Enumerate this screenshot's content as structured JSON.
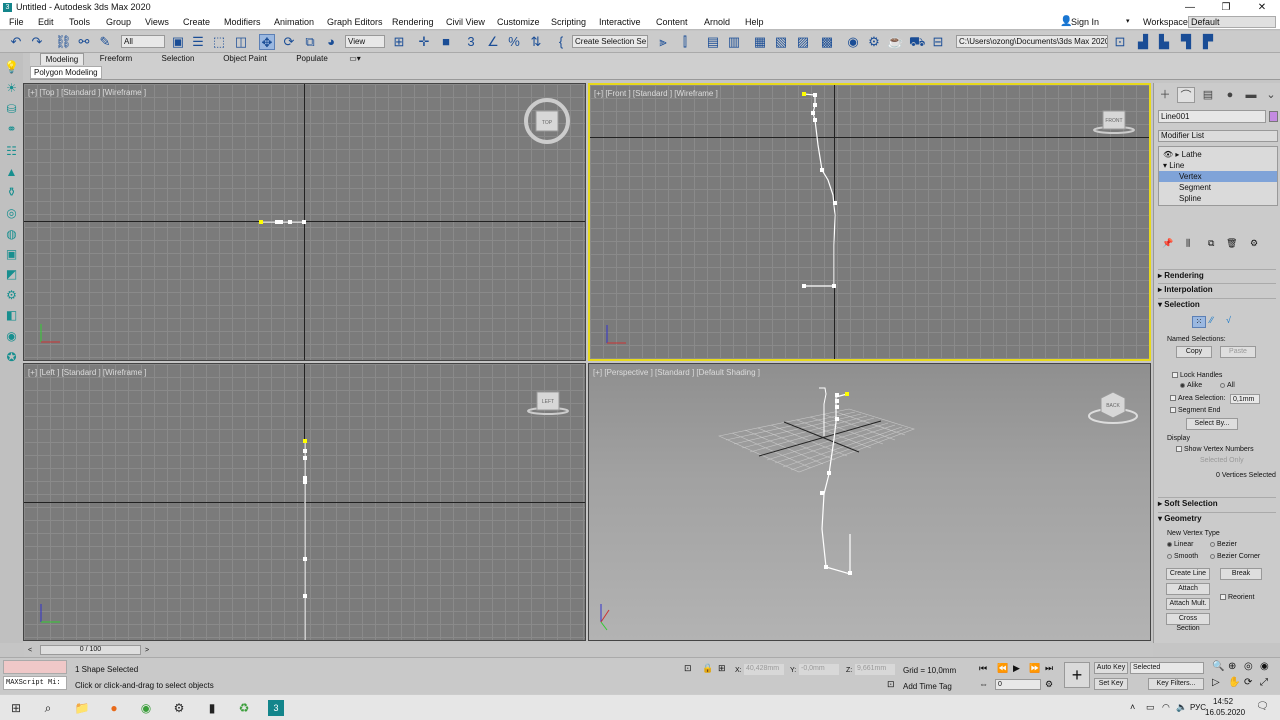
{
  "window": {
    "title": "Untitled - Autodesk 3ds Max 2020",
    "logo": "3",
    "minimize": "—",
    "maximize": "❐",
    "close": "✕"
  },
  "menu": [
    "File",
    "Edit",
    "Tools",
    "Group",
    "Views",
    "Create",
    "Modifiers",
    "Animation",
    "Graph Editors",
    "Rendering",
    "Civil View",
    "Customize",
    "Scripting",
    "Interactive",
    "Content",
    "Arnold",
    "Help"
  ],
  "signin": {
    "label": "Sign In",
    "icon": "user-icon"
  },
  "workspaces": {
    "label": "Workspaces:",
    "value": "Default"
  },
  "toolbar": {
    "filter": "All",
    "view": "View",
    "selection_set": "Create Selection Se",
    "project_path": "C:\\Users\\ozong\\Documents\\3ds Max 2020"
  },
  "ribbon": {
    "tabs": [
      "Modeling",
      "Freeform",
      "Selection",
      "Object Paint",
      "Populate"
    ],
    "active": "Modeling",
    "sub_label": "Polygon Modeling"
  },
  "viewports": {
    "top": {
      "label": "[+] [Top ] [Standard ] [Wireframe ]",
      "cube": "TOP"
    },
    "front": {
      "label": "[+] [Front ] [Standard ] [Wireframe ]",
      "cube": "FRONT"
    },
    "left": {
      "label": "[+] [Left ] [Standard ] [Wireframe ]",
      "cube": "LEFT"
    },
    "persp": {
      "label": "[+] [Perspective ] [Standard ] [Default Shading ]",
      "cube": "BACK"
    }
  },
  "command_panel": {
    "object_name": "Line001",
    "object_color": "#c48be2",
    "modifier_list": "Modifier List",
    "stack": [
      {
        "label": "Lathe",
        "indent": 1
      },
      {
        "label": "Line",
        "indent": 0
      },
      {
        "label": "Vertex",
        "indent": 2,
        "selected": true
      },
      {
        "label": "Segment",
        "indent": 2
      },
      {
        "label": "Spline",
        "indent": 2
      }
    ],
    "rollouts": {
      "rendering": "Rendering",
      "interpolation": "Interpolation",
      "selection": "Selection",
      "soft_selection": "Soft Selection",
      "geometry": "Geometry"
    },
    "selection": {
      "named_selections": "Named Selections:",
      "copy": "Copy",
      "paste": "Paste",
      "lock_handles": "Lock Handles",
      "alike": "Alike",
      "all": "All",
      "area_selection": "Area Selection:",
      "area_value": "0,1mm",
      "segment_end": "Segment End",
      "select_by": "Select By...",
      "display": "Display",
      "show_vertex_numbers": "Show Vertex Numbers",
      "selected_only": "Selected Only",
      "vertices_selected": "0 Vertices Selected"
    },
    "geometry": {
      "new_vertex_type": "New Vertex Type",
      "linear": "Linear",
      "bezier": "Bezier",
      "smooth": "Smooth",
      "bezier_corner": "Bezier Corner",
      "create_line": "Create Line",
      "break": "Break",
      "attach": "Attach",
      "reorient": "Reorient",
      "attach_mult": "Attach Mult.",
      "cross_section": "Cross Section"
    }
  },
  "timebar": {
    "frame": "0 / 100"
  },
  "status": {
    "shape_selected": "1 Shape Selected",
    "prompt": "Click or click-and-drag to select objects",
    "maxscript": "MAXScript Mi:",
    "x_label": "X:",
    "x_value": "40,428mm",
    "y_label": "Y:",
    "y_value": "-0,0mm",
    "z_label": "Z:",
    "z_value": "9,661mm",
    "grid": "Grid = 10,0mm",
    "add_time_tag": "Add Time Tag",
    "auto_key": "Auto Key",
    "set_key": "Set Key",
    "selected": "Selected",
    "key_filters": "Key Filters...",
    "frame_value": "0"
  },
  "taskbar": {
    "lang": "РУС",
    "time": "14:52",
    "date": "16.05.2020"
  }
}
